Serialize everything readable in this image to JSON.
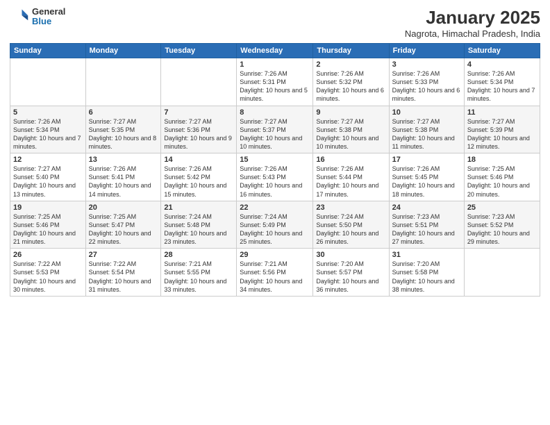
{
  "header": {
    "logo": {
      "general": "General",
      "blue": "Blue"
    },
    "title": "January 2025",
    "subtitle": "Nagrota, Himachal Pradesh, India"
  },
  "weekdays": [
    "Sunday",
    "Monday",
    "Tuesday",
    "Wednesday",
    "Thursday",
    "Friday",
    "Saturday"
  ],
  "weeks": [
    [
      {
        "day": "",
        "sunrise": "",
        "sunset": "",
        "daylight": ""
      },
      {
        "day": "",
        "sunrise": "",
        "sunset": "",
        "daylight": ""
      },
      {
        "day": "",
        "sunrise": "",
        "sunset": "",
        "daylight": ""
      },
      {
        "day": "1",
        "sunrise": "Sunrise: 7:26 AM",
        "sunset": "Sunset: 5:31 PM",
        "daylight": "Daylight: 10 hours and 5 minutes."
      },
      {
        "day": "2",
        "sunrise": "Sunrise: 7:26 AM",
        "sunset": "Sunset: 5:32 PM",
        "daylight": "Daylight: 10 hours and 6 minutes."
      },
      {
        "day": "3",
        "sunrise": "Sunrise: 7:26 AM",
        "sunset": "Sunset: 5:33 PM",
        "daylight": "Daylight: 10 hours and 6 minutes."
      },
      {
        "day": "4",
        "sunrise": "Sunrise: 7:26 AM",
        "sunset": "Sunset: 5:34 PM",
        "daylight": "Daylight: 10 hours and 7 minutes."
      }
    ],
    [
      {
        "day": "5",
        "sunrise": "Sunrise: 7:26 AM",
        "sunset": "Sunset: 5:34 PM",
        "daylight": "Daylight: 10 hours and 7 minutes."
      },
      {
        "day": "6",
        "sunrise": "Sunrise: 7:27 AM",
        "sunset": "Sunset: 5:35 PM",
        "daylight": "Daylight: 10 hours and 8 minutes."
      },
      {
        "day": "7",
        "sunrise": "Sunrise: 7:27 AM",
        "sunset": "Sunset: 5:36 PM",
        "daylight": "Daylight: 10 hours and 9 minutes."
      },
      {
        "day": "8",
        "sunrise": "Sunrise: 7:27 AM",
        "sunset": "Sunset: 5:37 PM",
        "daylight": "Daylight: 10 hours and 10 minutes."
      },
      {
        "day": "9",
        "sunrise": "Sunrise: 7:27 AM",
        "sunset": "Sunset: 5:38 PM",
        "daylight": "Daylight: 10 hours and 10 minutes."
      },
      {
        "day": "10",
        "sunrise": "Sunrise: 7:27 AM",
        "sunset": "Sunset: 5:38 PM",
        "daylight": "Daylight: 10 hours and 11 minutes."
      },
      {
        "day": "11",
        "sunrise": "Sunrise: 7:27 AM",
        "sunset": "Sunset: 5:39 PM",
        "daylight": "Daylight: 10 hours and 12 minutes."
      }
    ],
    [
      {
        "day": "12",
        "sunrise": "Sunrise: 7:27 AM",
        "sunset": "Sunset: 5:40 PM",
        "daylight": "Daylight: 10 hours and 13 minutes."
      },
      {
        "day": "13",
        "sunrise": "Sunrise: 7:26 AM",
        "sunset": "Sunset: 5:41 PM",
        "daylight": "Daylight: 10 hours and 14 minutes."
      },
      {
        "day": "14",
        "sunrise": "Sunrise: 7:26 AM",
        "sunset": "Sunset: 5:42 PM",
        "daylight": "Daylight: 10 hours and 15 minutes."
      },
      {
        "day": "15",
        "sunrise": "Sunrise: 7:26 AM",
        "sunset": "Sunset: 5:43 PM",
        "daylight": "Daylight: 10 hours and 16 minutes."
      },
      {
        "day": "16",
        "sunrise": "Sunrise: 7:26 AM",
        "sunset": "Sunset: 5:44 PM",
        "daylight": "Daylight: 10 hours and 17 minutes."
      },
      {
        "day": "17",
        "sunrise": "Sunrise: 7:26 AM",
        "sunset": "Sunset: 5:45 PM",
        "daylight": "Daylight: 10 hours and 18 minutes."
      },
      {
        "day": "18",
        "sunrise": "Sunrise: 7:25 AM",
        "sunset": "Sunset: 5:46 PM",
        "daylight": "Daylight: 10 hours and 20 minutes."
      }
    ],
    [
      {
        "day": "19",
        "sunrise": "Sunrise: 7:25 AM",
        "sunset": "Sunset: 5:46 PM",
        "daylight": "Daylight: 10 hours and 21 minutes."
      },
      {
        "day": "20",
        "sunrise": "Sunrise: 7:25 AM",
        "sunset": "Sunset: 5:47 PM",
        "daylight": "Daylight: 10 hours and 22 minutes."
      },
      {
        "day": "21",
        "sunrise": "Sunrise: 7:24 AM",
        "sunset": "Sunset: 5:48 PM",
        "daylight": "Daylight: 10 hours and 23 minutes."
      },
      {
        "day": "22",
        "sunrise": "Sunrise: 7:24 AM",
        "sunset": "Sunset: 5:49 PM",
        "daylight": "Daylight: 10 hours and 25 minutes."
      },
      {
        "day": "23",
        "sunrise": "Sunrise: 7:24 AM",
        "sunset": "Sunset: 5:50 PM",
        "daylight": "Daylight: 10 hours and 26 minutes."
      },
      {
        "day": "24",
        "sunrise": "Sunrise: 7:23 AM",
        "sunset": "Sunset: 5:51 PM",
        "daylight": "Daylight: 10 hours and 27 minutes."
      },
      {
        "day": "25",
        "sunrise": "Sunrise: 7:23 AM",
        "sunset": "Sunset: 5:52 PM",
        "daylight": "Daylight: 10 hours and 29 minutes."
      }
    ],
    [
      {
        "day": "26",
        "sunrise": "Sunrise: 7:22 AM",
        "sunset": "Sunset: 5:53 PM",
        "daylight": "Daylight: 10 hours and 30 minutes."
      },
      {
        "day": "27",
        "sunrise": "Sunrise: 7:22 AM",
        "sunset": "Sunset: 5:54 PM",
        "daylight": "Daylight: 10 hours and 31 minutes."
      },
      {
        "day": "28",
        "sunrise": "Sunrise: 7:21 AM",
        "sunset": "Sunset: 5:55 PM",
        "daylight": "Daylight: 10 hours and 33 minutes."
      },
      {
        "day": "29",
        "sunrise": "Sunrise: 7:21 AM",
        "sunset": "Sunset: 5:56 PM",
        "daylight": "Daylight: 10 hours and 34 minutes."
      },
      {
        "day": "30",
        "sunrise": "Sunrise: 7:20 AM",
        "sunset": "Sunset: 5:57 PM",
        "daylight": "Daylight: 10 hours and 36 minutes."
      },
      {
        "day": "31",
        "sunrise": "Sunrise: 7:20 AM",
        "sunset": "Sunset: 5:58 PM",
        "daylight": "Daylight: 10 hours and 38 minutes."
      },
      {
        "day": "",
        "sunrise": "",
        "sunset": "",
        "daylight": ""
      }
    ]
  ]
}
